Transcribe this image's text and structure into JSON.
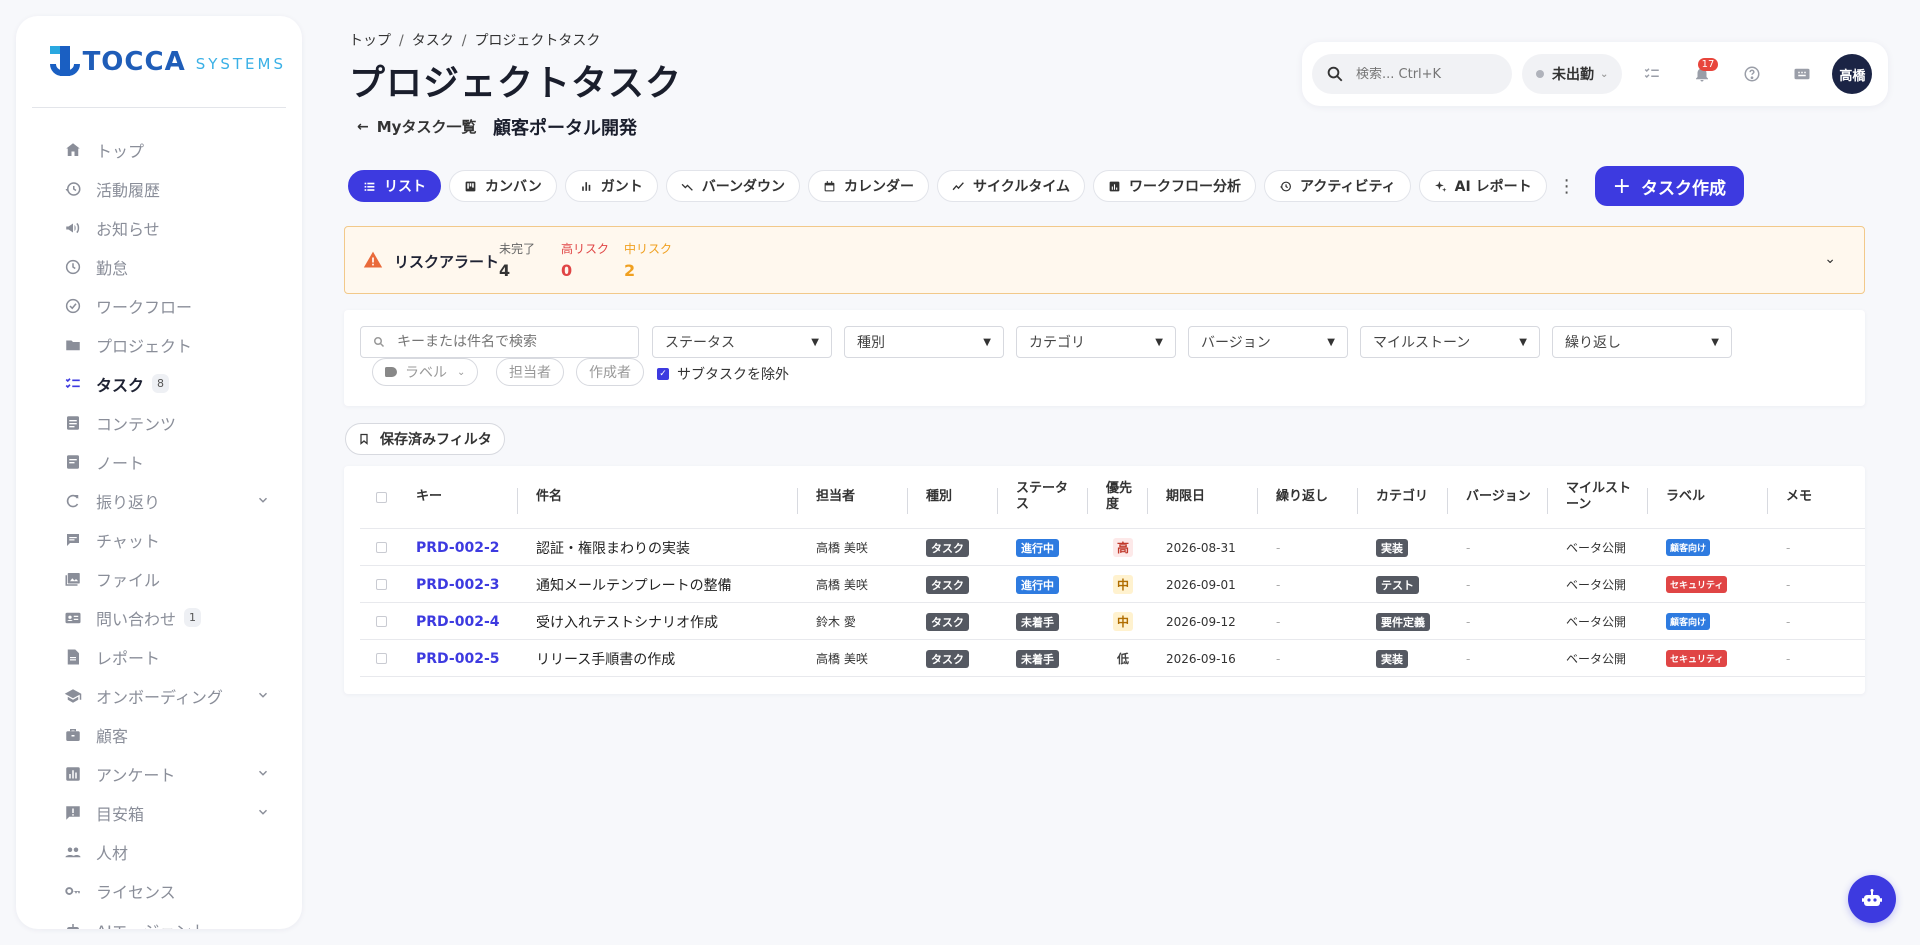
{
  "brand": {
    "name": "TOCCA",
    "sub": "SYSTEMS"
  },
  "sidebar": {
    "items": [
      {
        "label": "トップ",
        "icon": "home-icon"
      },
      {
        "label": "活動履歴",
        "icon": "history-icon"
      },
      {
        "label": "お知らせ",
        "icon": "megaphone-icon"
      },
      {
        "label": "勤怠",
        "icon": "clock-icon"
      },
      {
        "label": "ワークフロー",
        "icon": "check-circle-icon"
      },
      {
        "label": "プロジェクト",
        "icon": "folder-icon"
      },
      {
        "label": "タスク",
        "icon": "checklist-icon",
        "badge": "8",
        "active": true
      },
      {
        "label": "コンテンツ",
        "icon": "document-icon"
      },
      {
        "label": "ノート",
        "icon": "note-icon"
      },
      {
        "label": "振り返り",
        "icon": "refresh-icon",
        "expandable": true
      },
      {
        "label": "チャット",
        "icon": "chat-icon"
      },
      {
        "label": "ファイル",
        "icon": "image-icon"
      },
      {
        "label": "問い合わせ",
        "icon": "contact-card-icon",
        "badge": "1"
      },
      {
        "label": "レポート",
        "icon": "report-icon"
      },
      {
        "label": "オンボーディング",
        "icon": "school-icon",
        "expandable": true
      },
      {
        "label": "顧客",
        "icon": "briefcase-icon"
      },
      {
        "label": "アンケート",
        "icon": "bar-chart-icon",
        "expandable": true
      },
      {
        "label": "目安箱",
        "icon": "feedback-icon",
        "expandable": true
      },
      {
        "label": "人材",
        "icon": "people-icon"
      },
      {
        "label": "ライセンス",
        "icon": "key-icon"
      },
      {
        "label": "AIエージェント",
        "icon": "robot-icon"
      }
    ]
  },
  "breadcrumb": [
    "トップ",
    "タスク",
    "プロジェクトタスク"
  ],
  "page_title": "プロジェクトタスク",
  "back_link": "Myタスク一覧",
  "project_name": "顧客ポータル開発",
  "topbar": {
    "search_placeholder": "検索... Ctrl+K",
    "status": "未出勤",
    "notifications": "17",
    "avatar": "高橋"
  },
  "tabs": [
    {
      "label": "リスト",
      "icon": "list-icon",
      "active": true
    },
    {
      "label": "カンバン",
      "icon": "kanban-icon"
    },
    {
      "label": "ガント",
      "icon": "gantt-icon"
    },
    {
      "label": "バーンダウン",
      "icon": "burndown-icon"
    },
    {
      "label": "カレンダー",
      "icon": "calendar-icon"
    },
    {
      "label": "サイクルタイム",
      "icon": "trend-icon"
    },
    {
      "label": "ワークフロー分析",
      "icon": "analytics-icon"
    },
    {
      "label": "アクティビティ",
      "icon": "activity-icon"
    },
    {
      "label": "AI レポート",
      "icon": "sparkle-icon"
    }
  ],
  "create_button": "タスク作成",
  "risk": {
    "title": "リスクアラート",
    "stats": [
      {
        "label": "未完了",
        "value": "4",
        "color": "#333333"
      },
      {
        "label": "高リスク",
        "value": "0",
        "color": "#e04545"
      },
      {
        "label": "中リスク",
        "value": "2",
        "color": "#f0a020"
      }
    ]
  },
  "filters": {
    "search_placeholder": "キーまたは件名で検索",
    "selects": [
      "ステータス",
      "種別",
      "カテゴリ",
      "バージョン",
      "マイルストーン",
      "繰り返し"
    ],
    "chips": [
      "ラベル",
      "担当者",
      "作成者"
    ],
    "exclude_subtasks": "サブタスクを除外"
  },
  "saved_filter": "保存済みフィルタ",
  "table": {
    "headers": [
      "キー",
      "件名",
      "担当者",
      "種別",
      "ステータス",
      "優先度",
      "期限日",
      "繰り返し",
      "カテゴリ",
      "バージョン",
      "マイルストーン",
      "ラベル",
      "メモ"
    ],
    "rows": [
      {
        "key": "PRD-002-2",
        "subject": "認証・権限まわりの実装",
        "assignee": "高橋 美咲",
        "type": "タスク",
        "status": "進行中",
        "priority": "高",
        "due": "2026-08-31",
        "recurrence": "-",
        "category": "実装",
        "version": "-",
        "milestone": "ベータ公開",
        "label": "顧客向け",
        "memo": "-"
      },
      {
        "key": "PRD-002-3",
        "subject": "通知メールテンプレートの整備",
        "assignee": "高橋 美咲",
        "type": "タスク",
        "status": "進行中",
        "priority": "中",
        "due": "2026-09-01",
        "recurrence": "-",
        "category": "テスト",
        "version": "-",
        "milestone": "ベータ公開",
        "label": "セキュリティ",
        "memo": "-"
      },
      {
        "key": "PRD-002-4",
        "subject": "受け入れテストシナリオ作成",
        "assignee": "鈴木 愛",
        "type": "タスク",
        "status": "未着手",
        "priority": "中",
        "due": "2026-09-12",
        "recurrence": "-",
        "category": "要件定義",
        "version": "-",
        "milestone": "ベータ公開",
        "label": "顧客向け",
        "memo": "-"
      },
      {
        "key": "PRD-002-5",
        "subject": "リリース手順書の作成",
        "assignee": "高橋 美咲",
        "type": "タスク",
        "status": "未着手",
        "priority": "低",
        "due": "2026-09-16",
        "recurrence": "-",
        "category": "実装",
        "version": "-",
        "milestone": "ベータ公開",
        "label": "セキュリティ",
        "memo": "-"
      }
    ]
  },
  "colors": {
    "accent": "#3d3ae0",
    "brand": "#1f5db8"
  }
}
